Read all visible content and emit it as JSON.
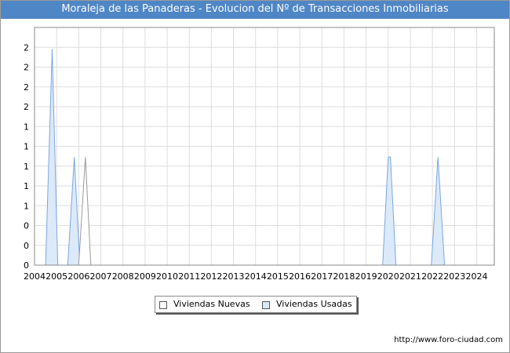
{
  "title": "Moraleja de las Panaderas - Evolucion del Nº de Transacciones Inmobiliarias",
  "footer_url": "http://www.foro-ciudad.com",
  "chart_data": {
    "type": "area",
    "title": "Moraleja de las Panaderas - Evolucion del Nº de Transacciones Inmobiliarias",
    "xlabel": "",
    "ylabel": "",
    "x_ticks": [
      "2004",
      "2005",
      "2006",
      "2007",
      "2008",
      "2009",
      "2010",
      "2011",
      "2012",
      "2013",
      "2014",
      "2015",
      "2016",
      "2017",
      "2018",
      "2019",
      "2020",
      "2021",
      "2022",
      "2023",
      "2024"
    ],
    "y_ticks": [
      "0",
      "0",
      "0",
      "1",
      "1",
      "1",
      "1",
      "1",
      "2",
      "2",
      "2",
      "2"
    ],
    "ylim": [
      0,
      2.2
    ],
    "xlim": [
      2004.0,
      2024.8
    ],
    "grid": true,
    "legend_position": "bottom-center",
    "series": [
      {
        "name": "Viviendas Nuevas",
        "color": "#999999",
        "fill": "#ffffff",
        "points": [
          [
            2006.0,
            0
          ],
          [
            2006.3,
            1
          ],
          [
            2006.55,
            0
          ]
        ]
      },
      {
        "name": "Viviendas Usadas",
        "color": "#7aa7e0",
        "fill": "#dce9f9",
        "points": [
          [
            2004.5,
            0
          ],
          [
            2004.8,
            2
          ],
          [
            2005.05,
            0
          ],
          [
            2005.5,
            0
          ],
          [
            2005.8,
            1
          ],
          [
            2006.05,
            0
          ],
          [
            2019.75,
            0
          ],
          [
            2020.0,
            1
          ],
          [
            2020.1,
            1
          ],
          [
            2020.35,
            0
          ],
          [
            2021.95,
            0
          ],
          [
            2022.25,
            1
          ],
          [
            2022.55,
            0
          ]
        ]
      }
    ]
  }
}
